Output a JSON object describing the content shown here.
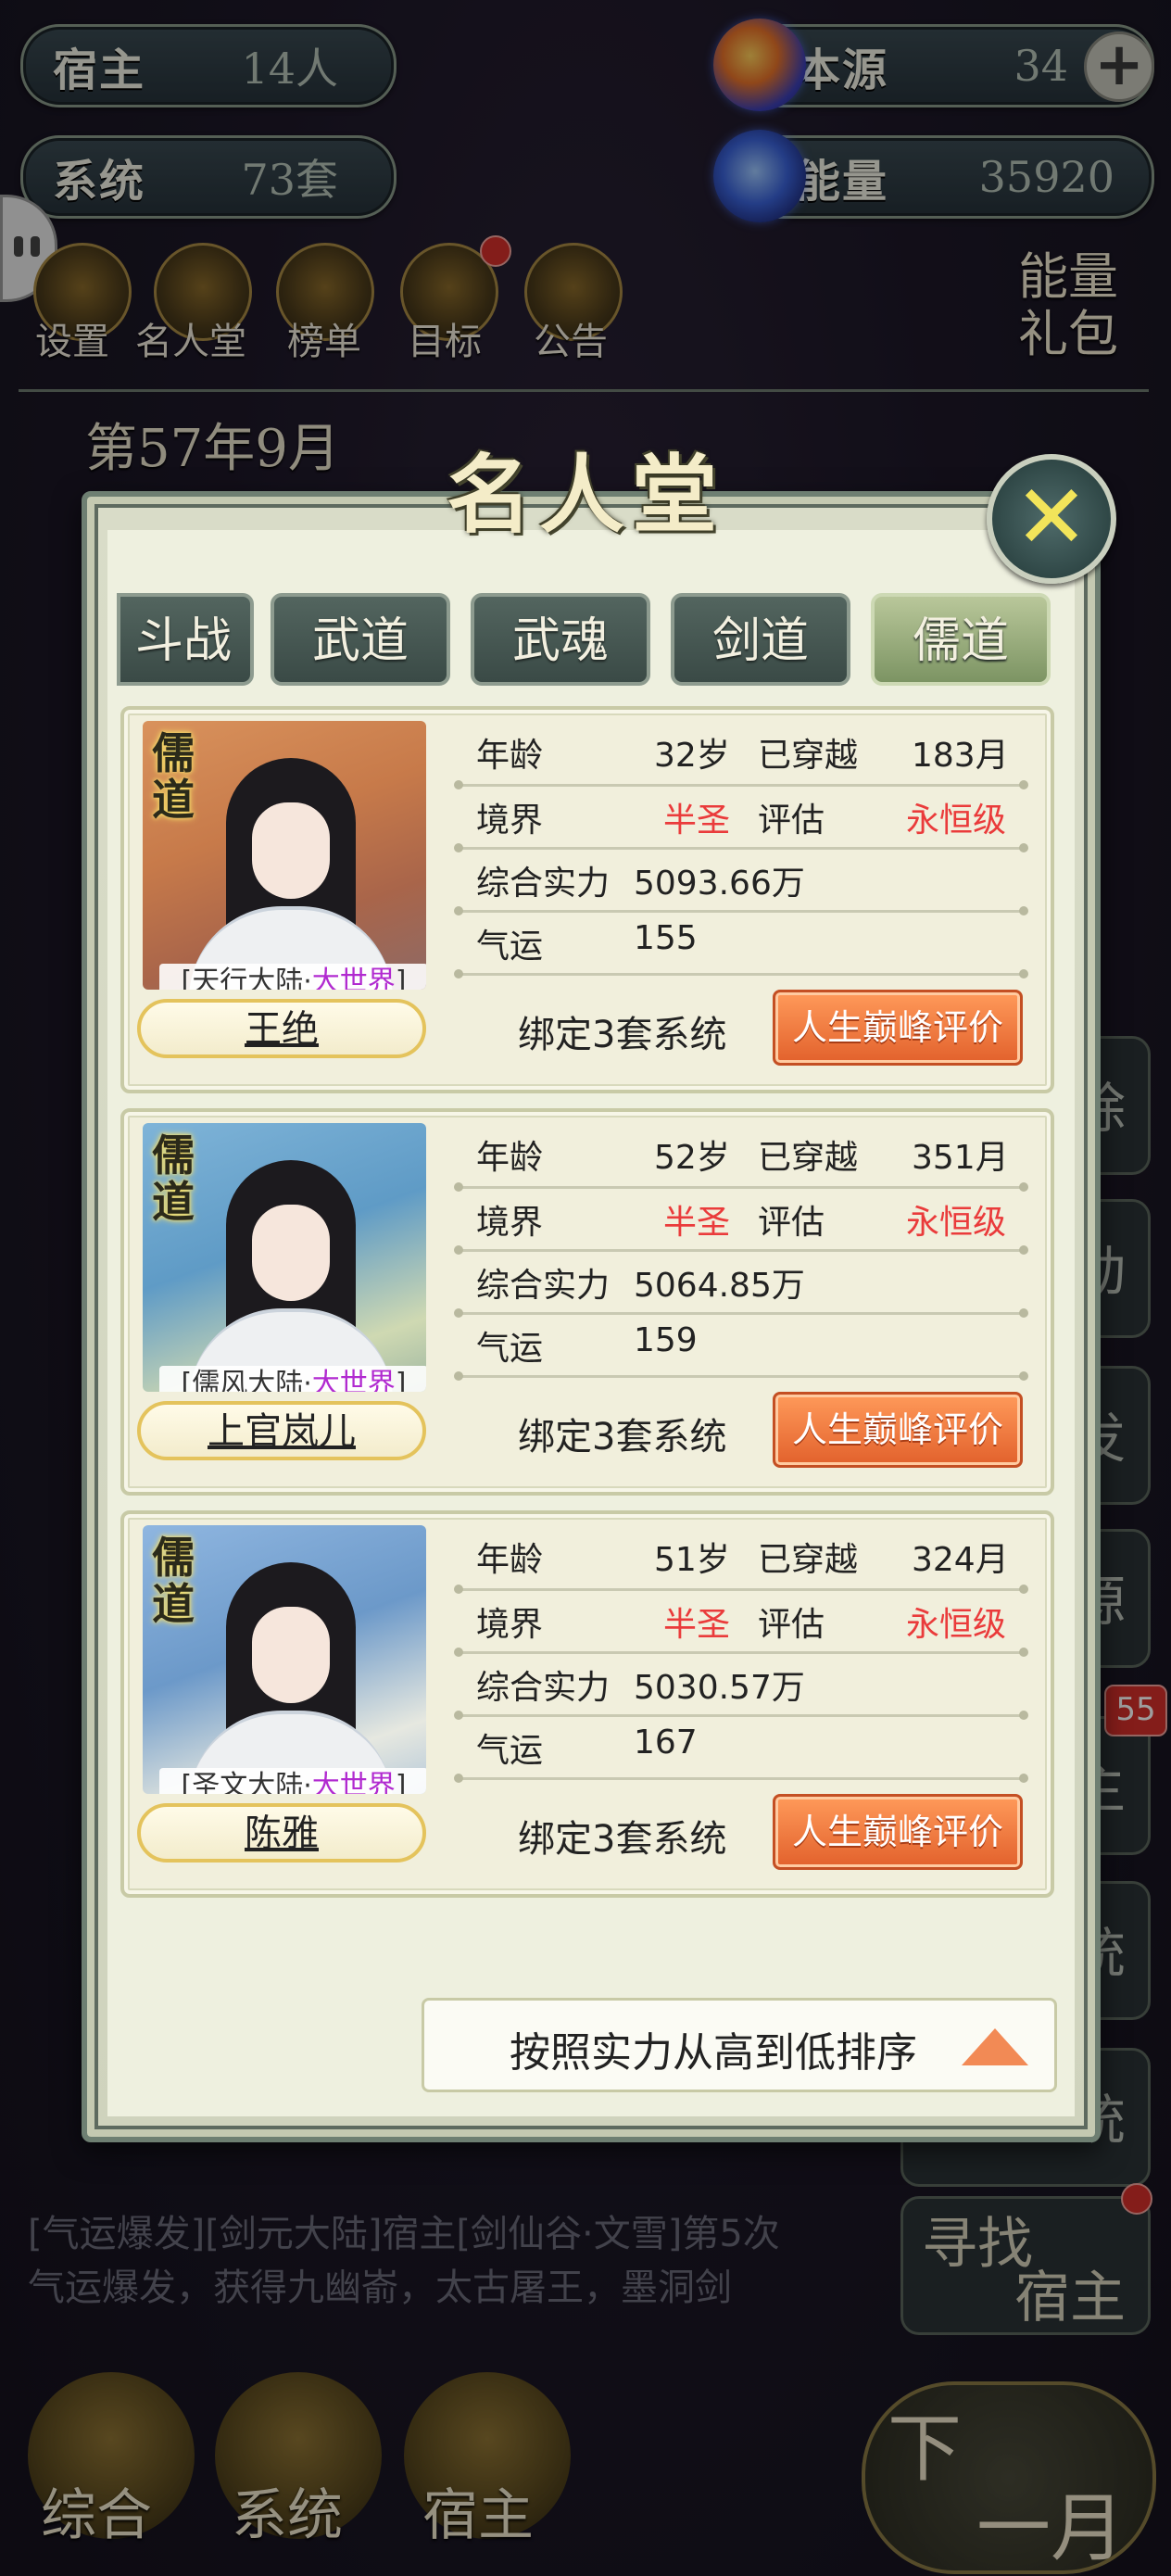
{
  "hud": {
    "host_label": "宿主",
    "host_value": "14人",
    "source_label": "本源",
    "source_value": "34",
    "system_label": "系统",
    "system_value": "73套",
    "energy_label": "能量",
    "energy_value": "35920",
    "plus": "+"
  },
  "menu": [
    "设置",
    "名人堂",
    "榜单",
    "目标",
    "公告"
  ],
  "gift": [
    "能量",
    "礼包"
  ],
  "date": "第57年9月",
  "log_bottom": [
    "[气运爆发][剑元大陆]宿主[剑仙谷·文雪]第5次",
    "气运爆发，获得九幽嵛，太古屠王，墨洞剑"
  ],
  "side_buttons": [
    "除",
    "动",
    "发",
    "源",
    "主",
    "统",
    "统"
  ],
  "side_badge": "55",
  "find_host": [
    "寻找",
    "宿主"
  ],
  "bottom_nav": [
    "综合",
    "系统",
    "宿主"
  ],
  "next_month": [
    "下",
    "一月"
  ],
  "modal": {
    "title": "名人堂",
    "close": "✕",
    "tabs": [
      "斗战",
      "武道",
      "武魂",
      "剑道",
      "儒道"
    ],
    "active_tab": "儒道",
    "sort_label": "按照实力从高到低排序",
    "stat_labels": {
      "age": "年龄",
      "traveled": "已穿越",
      "realm": "境界",
      "eval": "评估",
      "power": "综合实力",
      "luck": "气运"
    },
    "peak_label": "人生巅峰评价",
    "cards": [
      {
        "badge": "儒道",
        "region_prefix": "[天行大陆·",
        "region_tag": "大世界",
        "region_suffix": "]",
        "name": "王绝",
        "age": "32岁",
        "traveled": "183月",
        "realm": "半圣",
        "eval": "永恒级",
        "power": "5093.66万",
        "luck": "155",
        "bound": "绑定3套系统"
      },
      {
        "badge": "儒道",
        "region_prefix": "[儒风大陆·",
        "region_tag": "大世界",
        "region_suffix": "]",
        "name": "上官岚儿",
        "age": "52岁",
        "traveled": "351月",
        "realm": "半圣",
        "eval": "永恒级",
        "power": "5064.85万",
        "luck": "159",
        "bound": "绑定3套系统"
      },
      {
        "badge": "儒道",
        "region_prefix": "[圣文大陆·",
        "region_tag": "大世界",
        "region_suffix": "]",
        "name": "陈雅",
        "age": "51岁",
        "traveled": "324月",
        "realm": "半圣",
        "eval": "永恒级",
        "power": "5030.57万",
        "luck": "167",
        "bound": "绑定3套系统"
      }
    ]
  }
}
